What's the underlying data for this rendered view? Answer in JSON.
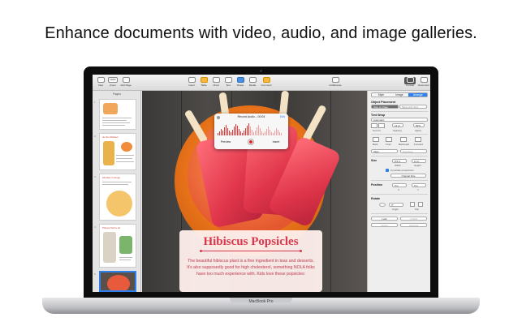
{
  "headline": "Enhance documents with video, audio, and image galleries.",
  "device": {
    "label": "MacBook Pro"
  },
  "toolbar": {
    "items": [
      {
        "label": "View"
      },
      {
        "label": "Zoom"
      },
      {
        "label": "Add Page"
      },
      {
        "label": "Insert"
      },
      {
        "label": "Table"
      },
      {
        "label": "Chart"
      },
      {
        "label": "Text"
      },
      {
        "label": "Shape"
      },
      {
        "label": "Media"
      },
      {
        "label": "Comment"
      },
      {
        "label": "Collaborate"
      },
      {
        "label": "Format"
      },
      {
        "label": "Document"
      }
    ],
    "zoom_value": "101%"
  },
  "pages_sidebar": {
    "title": "Pages",
    "thumbs": [
      {
        "num": "1",
        "title": ""
      },
      {
        "num": "2",
        "title": "At the Market"
      },
      {
        "num": "3",
        "title": "Mother College"
      },
      {
        "num": "4",
        "title": "Where We're At"
      },
      {
        "num": "5",
        "title": ""
      }
    ]
  },
  "audio_popover": {
    "title": "Record Audio – 00:04",
    "edit_label": "Edit",
    "preview_label": "Preview",
    "insert_label": "Insert"
  },
  "card": {
    "title": "Hibiscus Popsicles",
    "body": "The beautiful hibiscus plant is a fine ingredient in teas and desserts. It's also supposedly good for high cholesterol, something NOLA folks have too much experience with. Kids love these popsicles:"
  },
  "inspector": {
    "tabs": [
      "Style",
      "Image",
      "Arrange"
    ],
    "object_placement": "Object Placement",
    "placement_options": [
      "Stay on Page",
      "Move with Text"
    ],
    "text_wrap": "Text Wrap",
    "wrap_value": "Automatic",
    "text_fit": "Text Fit",
    "spacing_label": "Spacing",
    "spacing_value": "12 pt",
    "alpha_label": "Alpha",
    "alpha_value": "50%",
    "arrange_buttons": [
      "Back",
      "Front",
      "Backward",
      "Forward"
    ],
    "align_label": "Align",
    "distribute_label": "Distribute",
    "size_label": "Size",
    "width_label": "Width",
    "width_value": "8.5 in",
    "height_label": "Height",
    "height_value": "11 in",
    "constrain_label": "Constrain proportions",
    "original_size_label": "Original Size",
    "position_label": "Position",
    "x_label": "X",
    "x_value": "0 in",
    "y_label": "Y",
    "y_value": "0 in",
    "rotate_label": "Rotate",
    "angle_label": "Angle",
    "angle_value": "0°",
    "flip_label": "Flip",
    "lock_label": "Lock",
    "unlock_label": "Unlock",
    "group_label": "Group",
    "ungroup_label": "Ungroup"
  }
}
